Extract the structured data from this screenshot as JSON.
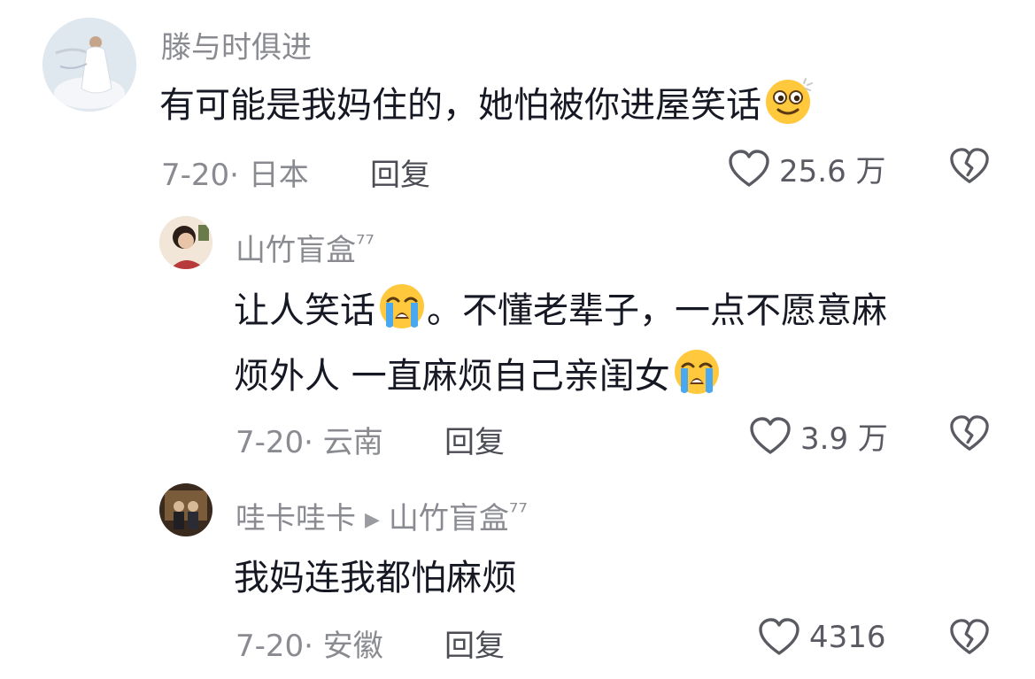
{
  "comments": [
    {
      "username": "滕与时俱进",
      "text_before": "有可能是我妈住的，她怕被你进屋笑话",
      "emoji": "dizzy-face-emoji",
      "date_loc": "7-20· 日本",
      "reply_label": "回复",
      "likes": "25.6 万"
    },
    {
      "username": "山竹盲盒",
      "name_mark": "⁷⁷",
      "line1_a": "让人笑话",
      "line1_emoji": "loudly-crying-emoji",
      "line1_b": "。不懂老辈子，一点不愿意麻",
      "line2_a": "烦外人 一直麻烦自己亲闺女",
      "line2_emoji": "loudly-crying-emoji",
      "date_loc": "7-20· 云南",
      "reply_label": "回复",
      "likes": "3.9 万"
    },
    {
      "username": "哇卡哇卡",
      "reply_to": "山竹盲盒",
      "name_mark": "⁷⁷",
      "text": "我妈连我都怕麻烦",
      "date_loc": "7-20· 安徽",
      "reply_label": "回复",
      "likes": "4316"
    }
  ],
  "icons": {
    "like": "heart-outline-icon",
    "dislike": "broken-heart-icon",
    "reply_arrow": "play-arrow-icon"
  },
  "colors": {
    "username": "#8a8b91",
    "text": "#161823",
    "meta": "#8a8b91",
    "emoji_yellow": "#ffc83d",
    "tear_blue": "#4aa8f0"
  }
}
